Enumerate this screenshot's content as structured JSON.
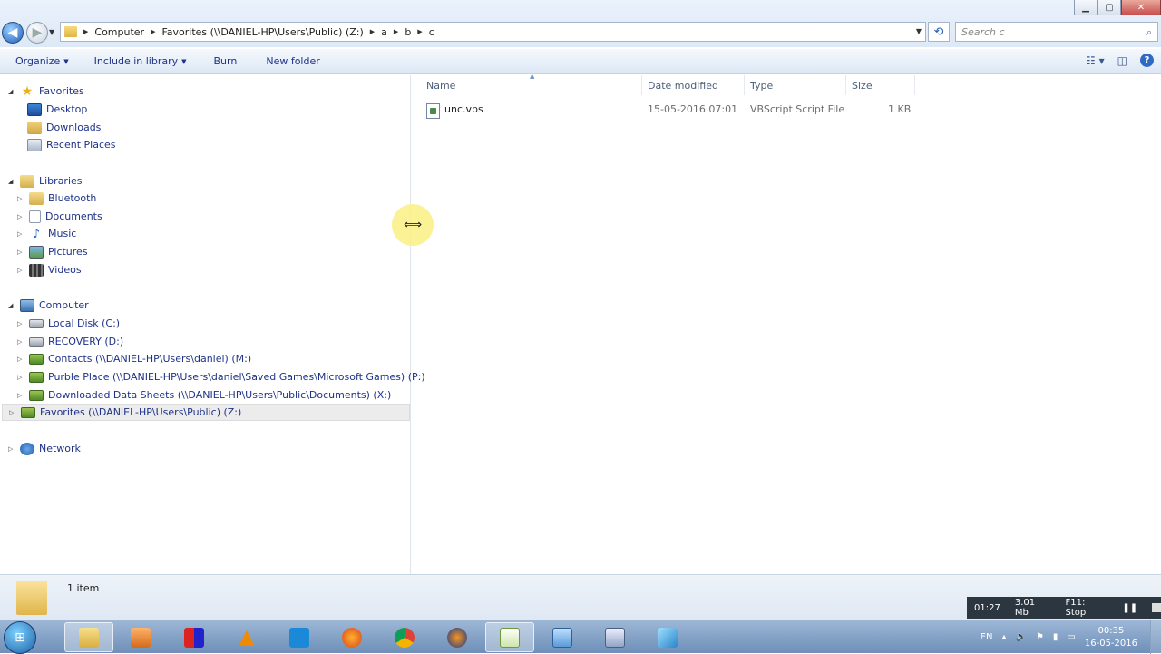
{
  "window": {
    "caption_buttons": [
      "minimize",
      "maximize",
      "close"
    ]
  },
  "address_bar": {
    "segments": [
      "Computer",
      "Favorites (\\\\DANIEL-HP\\Users\\Public) (Z:)",
      "a",
      "b",
      "c"
    ]
  },
  "search": {
    "placeholder": "Search c"
  },
  "command_bar": {
    "organize": "Organize",
    "include_in_library": "Include in library",
    "burn": "Burn",
    "new_folder": "New folder"
  },
  "nav": {
    "favorites": "Favorites",
    "desktop": "Desktop",
    "downloads": "Downloads",
    "recent_places": "Recent Places",
    "libraries": "Libraries",
    "bluetooth": "Bluetooth",
    "documents": "Documents",
    "music": "Music",
    "pictures": "Pictures",
    "videos": "Videos",
    "computer": "Computer",
    "local_disk": "Local Disk (C:)",
    "recovery": "RECOVERY (D:)",
    "contacts": "Contacts (\\\\DANIEL-HP\\Users\\daniel) (M:)",
    "purble_place": "Purble Place (\\\\DANIEL-HP\\Users\\daniel\\Saved Games\\Microsoft Games) (P:)",
    "downloaded_data_sheets": "Downloaded Data Sheets (\\\\DANIEL-HP\\Users\\Public\\Documents) (X:)",
    "favorites_drive": "Favorites (\\\\DANIEL-HP\\Users\\Public) (Z:)",
    "network": "Network"
  },
  "columns": {
    "name": "Name",
    "date_modified": "Date modified",
    "type": "Type",
    "size": "Size"
  },
  "files": [
    {
      "name": "unc.vbs",
      "date_modified": "15-05-2016 07:01",
      "type": "VBScript Script File",
      "size": "1 KB"
    }
  ],
  "status": {
    "item_count": "1 item"
  },
  "recorder": {
    "time": "01:27",
    "size": "3.01 Mb",
    "hint": "F11: Stop"
  },
  "taskbar": {
    "language": "EN",
    "time": "00:35",
    "date": "16-05-2016",
    "apps": [
      "windows-explorer",
      "media-player",
      "paint-app",
      "vlc",
      "screenshot-tool",
      "firefox",
      "chrome",
      "audacity",
      "notepad-chart",
      "remote-desktop",
      "window-app",
      "blue-app"
    ]
  }
}
